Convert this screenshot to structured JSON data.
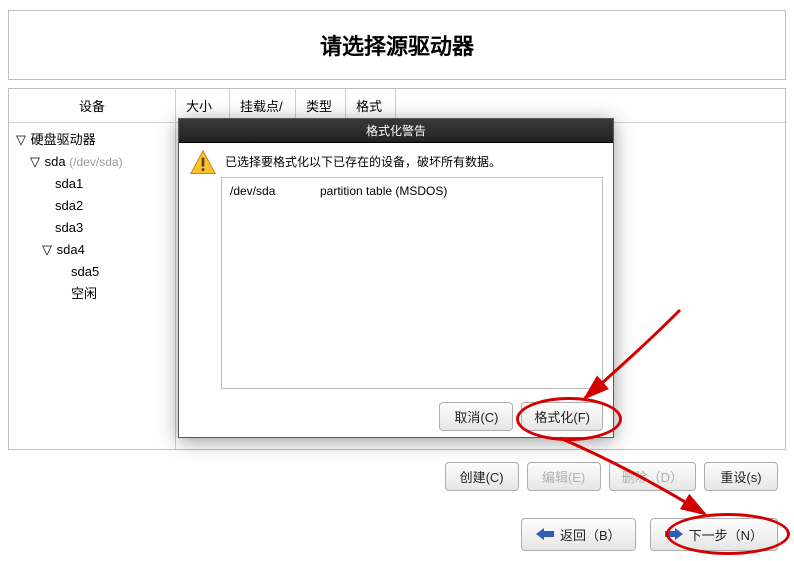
{
  "title": "请选择源驱动器",
  "leftHeader": "设备",
  "columns": {
    "size": "大小",
    "mount": "挂载点/",
    "type": "类型",
    "format": "格式"
  },
  "tree": {
    "root": "硬盘驱动器",
    "sda": "sda",
    "sdaPath": "(/dev/sda)",
    "sda1": "sda1",
    "sda2": "sda2",
    "sda3": "sda3",
    "sda4": "sda4",
    "sda5": "sda5",
    "free": "空闲"
  },
  "dialog": {
    "title": "格式化警告",
    "message": "已选择要格式化以下已存在的设备，破坏所有数据。",
    "device": "/dev/sda",
    "desc": "partition table (MSDOS)",
    "cancel": "取消(C)",
    "format": "格式化(F)"
  },
  "buttons": {
    "create": "创建(C)",
    "edit": "编辑(E)",
    "delete": "删除（D）",
    "reset": "重设(s)",
    "back": "返回（B）",
    "next": "下一步（N）"
  }
}
